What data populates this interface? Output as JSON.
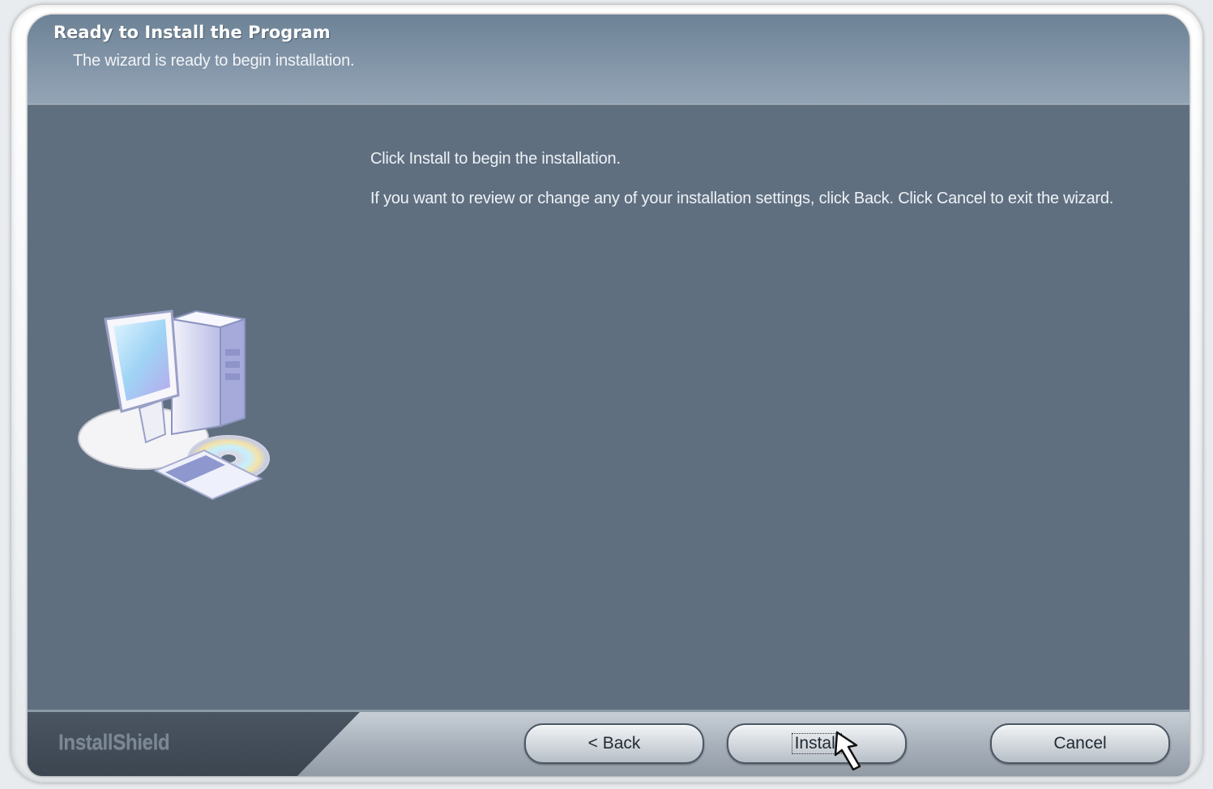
{
  "header": {
    "title": "Ready to Install the Program",
    "subtitle": "The wizard is ready to begin installation."
  },
  "body": {
    "line1": "Click Install to begin the installation.",
    "line2": "If you want to review or change any of your installation settings, click Back. Click Cancel to exit the wizard."
  },
  "footer": {
    "brand": "InstallShield",
    "back_label": "< Back",
    "install_label": "Install",
    "cancel_label": "Cancel"
  },
  "icons": {
    "illustration": "computer-cd-icon",
    "cursor": "mouse-pointer-icon"
  }
}
